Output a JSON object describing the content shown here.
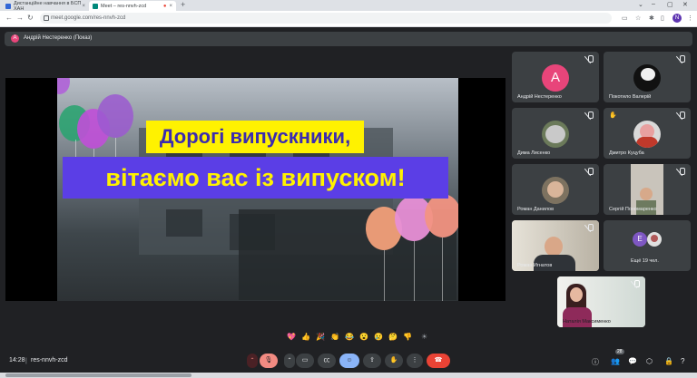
{
  "browser": {
    "tabs": [
      {
        "title": "Дистанційне навчання в БСП ХАН"
      },
      {
        "title": "Meet – res-nnvh-zcd"
      }
    ],
    "url": "meet.google.com/res-nnvh-zcd",
    "profile_initial": "N",
    "colors": {
      "tab_bar": "#dee1e6",
      "address_bar": "#ffffff"
    }
  },
  "meet": {
    "presenter": {
      "initial": "A",
      "label": "Андрій Нестеренко (Показ)"
    },
    "slide": {
      "line1": "Дорогі випускники,",
      "line2": "вітаємо вас із випуском!",
      "colors": {
        "line1_bg": "#fff200",
        "line1_text": "#3b2bb0",
        "line2_bg": "#5b3ee6",
        "line2_text": "#fff200"
      }
    },
    "participants": [
      {
        "name": "Андрій Нестеренко",
        "initial": "A",
        "avatar_color": "#e8457a"
      },
      {
        "name": "Покотило Валерій"
      },
      {
        "name": "Дима Лисенко"
      },
      {
        "name": "Дмитро Куцуба"
      },
      {
        "name": "Роман Данилов"
      },
      {
        "name": "Сергій Пономаренко"
      },
      {
        "name": "Роман Игнатов"
      },
      {
        "name": "Ещё 19 чел.",
        "initial": "E",
        "avatar_color": "#7e57c2"
      },
      {
        "name": "Наталія Максименко"
      }
    ],
    "reactions": [
      "💖",
      "👍",
      "🎉",
      "👏",
      "😂",
      "😮",
      "😢",
      "🤔",
      "👎",
      "☀"
    ],
    "bottom_bar": {
      "time": "14:28",
      "separator": "|",
      "meeting_code": "res-nnvh-zcd",
      "participant_count": "28"
    },
    "colors": {
      "background": "#202124",
      "tile": "#3c4043",
      "end_call": "#ea4335",
      "active_button": "#8ab4f8"
    }
  }
}
